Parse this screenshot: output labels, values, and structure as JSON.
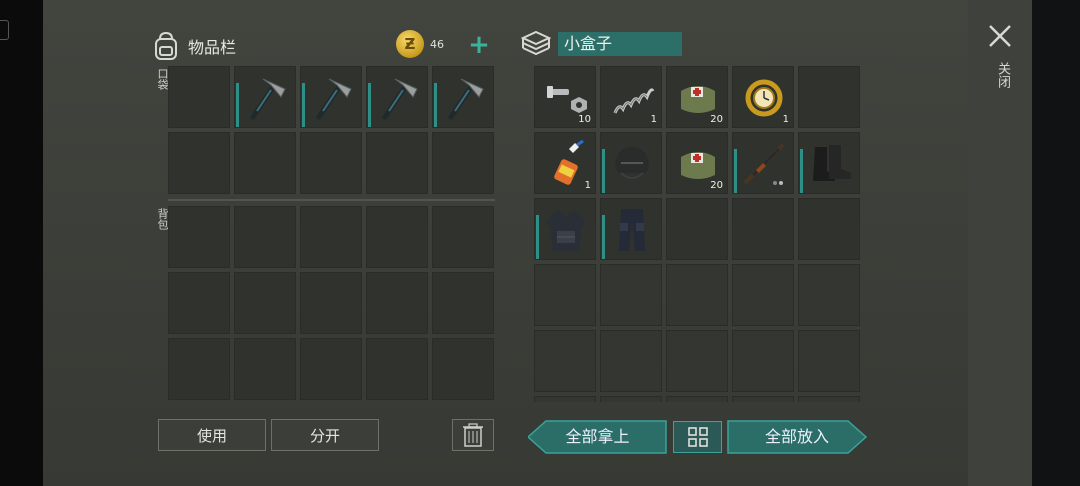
{
  "inventory": {
    "title": "物品栏",
    "coin_amount": "46",
    "plus_label": "+",
    "pocket_label": "口袋",
    "backpack_label": "背包",
    "pocket_slots": [
      {
        "item": "",
        "icon": ""
      },
      {
        "item": "pickaxe",
        "icon": "pickaxe-icon"
      },
      {
        "item": "pickaxe",
        "icon": "pickaxe-icon"
      },
      {
        "item": "pickaxe",
        "icon": "pickaxe-icon"
      },
      {
        "item": "pickaxe",
        "icon": "pickaxe-icon"
      }
    ]
  },
  "box": {
    "name": "小盒子",
    "items": [
      {
        "icon": "bolt-nut-icon",
        "count": "10"
      },
      {
        "icon": "spring-icon",
        "count": "1"
      },
      {
        "icon": "medkit-bag-icon",
        "count": "20"
      },
      {
        "icon": "gold-watch-icon",
        "count": "1"
      },
      {
        "icon": "",
        "count": ""
      },
      {
        "icon": "glue-bottle-icon",
        "count": "1"
      },
      {
        "icon": "helmet-icon",
        "count": ""
      },
      {
        "icon": "medkit-bag-icon",
        "count": "20"
      },
      {
        "icon": "rifle-icon",
        "count": ""
      },
      {
        "icon": "boots-icon",
        "count": ""
      },
      {
        "icon": "body-armor-icon",
        "count": ""
      },
      {
        "icon": "tactical-pants-icon",
        "count": ""
      }
    ]
  },
  "buttons": {
    "use": "使用",
    "split": "分开",
    "take_all": "全部拿上",
    "put_all": "全部放入",
    "close": "关闭"
  },
  "colors": {
    "accent": "#2d8f86",
    "coin": "#d9a925"
  }
}
